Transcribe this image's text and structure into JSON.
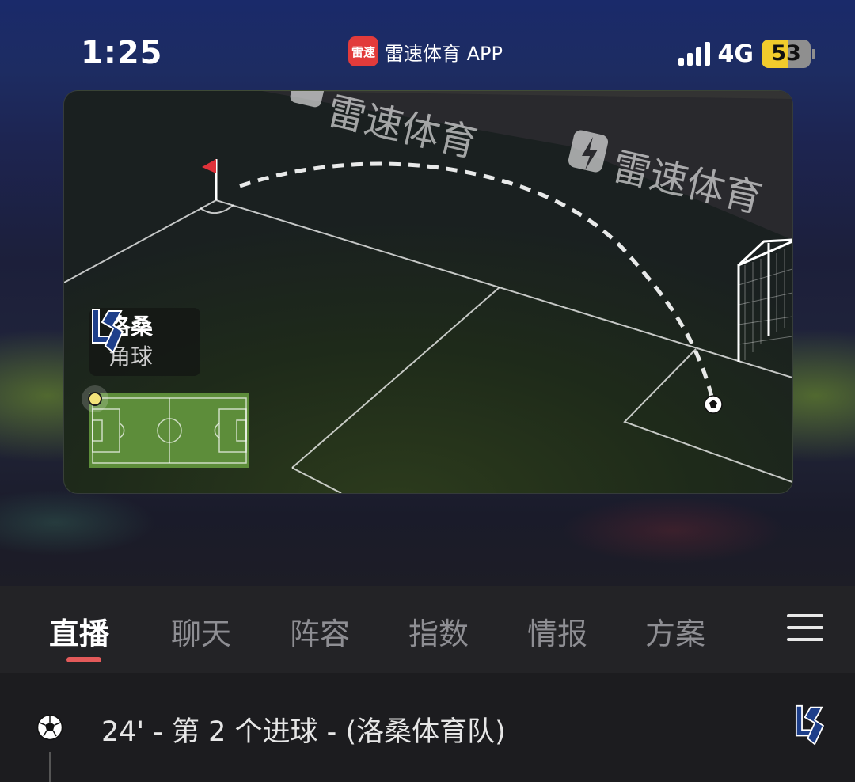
{
  "status_bar": {
    "time": "1:25",
    "app_logo_text": "雷速",
    "app_name": "雷速体育 APP",
    "network": "4G",
    "battery": "53",
    "battery_level": 0.53
  },
  "animation": {
    "banner_texts": [
      "雷速体育",
      "雷速体育"
    ],
    "event_team": "洛桑",
    "event_type": "角球"
  },
  "tabs": [
    {
      "label": "直播",
      "active": true
    },
    {
      "label": "聊天",
      "active": false
    },
    {
      "label": "阵容",
      "active": false
    },
    {
      "label": "指数",
      "active": false
    },
    {
      "label": "情报",
      "active": false
    },
    {
      "label": "方案",
      "active": false
    }
  ],
  "feed": [
    {
      "icon": "soccer-ball-icon",
      "text": "24' - 第 2 个进球 - (洛桑体育队)",
      "team_logo": "lausanne-logo-icon"
    }
  ],
  "colors": {
    "accent": "#e35a5a",
    "pitch": "#5d8d3a",
    "battery_fill": "#f2cc2c",
    "app_logo": "#e23b3b"
  }
}
